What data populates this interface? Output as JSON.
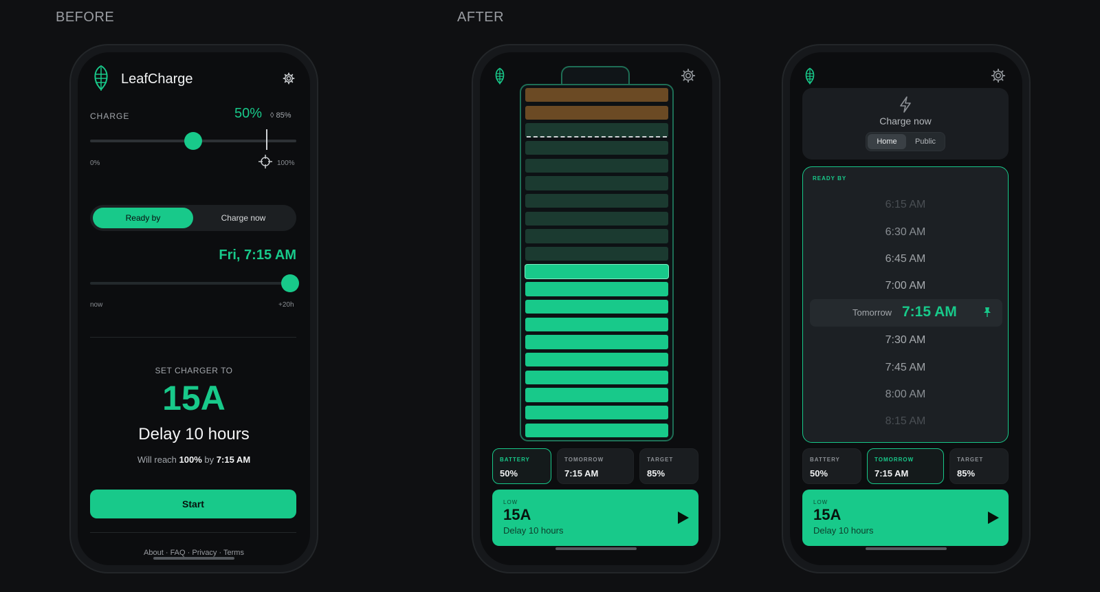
{
  "labels": {
    "before": "BEFORE",
    "after": "AFTER"
  },
  "before": {
    "app_name": "LeafCharge",
    "charge_label": "CHARGE",
    "charge_value": "50%",
    "target_value": "85%",
    "charge_level": 0.5,
    "target_level": 0.85,
    "slider_min": "0%",
    "slider_max": "100%",
    "mode_selected": "Ready by",
    "mode_other": "Charge now",
    "ready_time": "Fri, 7:15 AM",
    "time_min": "now",
    "time_max": "+20h",
    "time_level": 0.97,
    "set_charger_label": "SET CHARGER TO",
    "amps": "15A",
    "delay": "Delay 10 hours",
    "reach_prefix": "Will reach",
    "reach_pct": "100%",
    "reach_by": "by",
    "reach_time": "7:15 AM",
    "start_label": "Start",
    "footer": [
      "About",
      "FAQ",
      "Privacy",
      "Terms"
    ],
    "footer_sep": "·"
  },
  "after_battery": {
    "cards": [
      {
        "label": "BATTERY",
        "value": "50%",
        "selected": true
      },
      {
        "label": "TOMORROW",
        "value": "7:15 AM",
        "selected": false
      },
      {
        "label": "TARGET",
        "value": "85%",
        "selected": false
      }
    ],
    "action": {
      "label": "LOW",
      "amps": "15A",
      "sub": "Delay 10 hours"
    },
    "cells_total": 20,
    "cells_filled": 10,
    "cells_warning": 2,
    "target_line_after_cell": 3
  },
  "after_picker": {
    "charge_now": "Charge now",
    "tabs": [
      "Home",
      "Public"
    ],
    "ready_by": "READY BY",
    "times": [
      "6:15 AM",
      "6:30 AM",
      "6:45 AM",
      "7:00 AM",
      "7:30 AM",
      "7:45 AM",
      "8:00 AM",
      "8:15 AM"
    ],
    "selected_day": "Tomorrow",
    "selected_time": "7:15 AM",
    "cards": [
      {
        "label": "BATTERY",
        "value": "50%",
        "selected": false
      },
      {
        "label": "TOMORROW",
        "value": "7:15 AM",
        "selected": true
      },
      {
        "label": "TARGET",
        "value": "85%",
        "selected": false
      }
    ],
    "action": {
      "label": "LOW",
      "amps": "15A",
      "sub": "Delay 10 hours"
    }
  },
  "colors": {
    "accent": "#18c98a",
    "warning": "#6b4a24",
    "empty_cell": "#1b3a30",
    "background": "#0f1012"
  },
  "icons": [
    "leaf-logo-icon",
    "gear-icon",
    "crosshair-icon",
    "bolt-icon",
    "pin-icon",
    "play-icon"
  ]
}
